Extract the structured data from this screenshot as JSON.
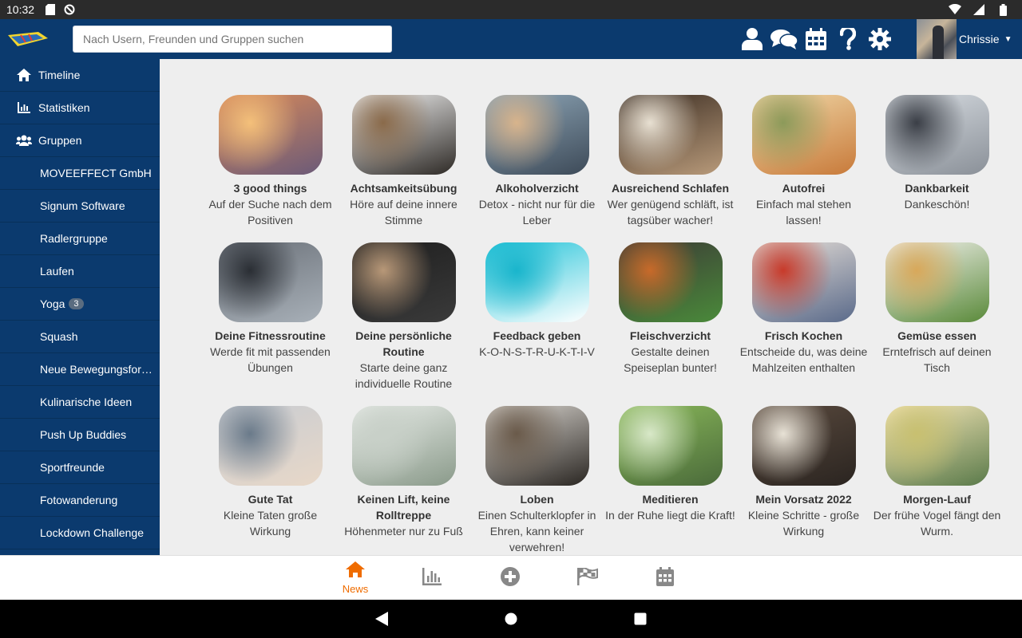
{
  "status_bar": {
    "time": "10:32"
  },
  "header": {
    "search_placeholder": "Nach Usern, Freunden und Gruppen suchen",
    "user_name": "Chrissie"
  },
  "sidebar": {
    "items": [
      {
        "label": "Timeline",
        "icon": "home-icon"
      },
      {
        "label": "Statistiken",
        "icon": "bar-chart-icon"
      },
      {
        "label": "Gruppen",
        "icon": "users-icon"
      }
    ],
    "groups": [
      {
        "label": "MOVEEFFECT GmbH"
      },
      {
        "label": "Signum Software"
      },
      {
        "label": "Radlergruppe"
      },
      {
        "label": "Laufen"
      },
      {
        "label": "Yoga",
        "badge": "3"
      },
      {
        "label": "Squash"
      },
      {
        "label": "Neue Bewegungsform..."
      },
      {
        "label": "Kulinarische Ideen"
      },
      {
        "label": "Push Up Buddies"
      },
      {
        "label": "Sportfreunde"
      },
      {
        "label": "Fotowanderung"
      },
      {
        "label": "Lockdown Challenge"
      }
    ]
  },
  "challenges": [
    {
      "title": "3 good things",
      "desc": "Auf der Suche nach dem Positiven",
      "colors": [
        "#d88a5a",
        "#f4c07a",
        "#6b5a78"
      ]
    },
    {
      "title": "Achtsamkeitsübung",
      "desc": "Höre auf deine innere Stimme",
      "colors": [
        "#f2f2f2",
        "#8a6a4a",
        "#2e2a26"
      ]
    },
    {
      "title": "Alkoholverzicht",
      "desc": "Detox - nicht nur für die Leber",
      "colors": [
        "#8fa7b8",
        "#d8b48c",
        "#3d4a58"
      ]
    },
    {
      "title": "Ausreichend Schlafen",
      "desc": "Wer genügend schläft, ist tagsüber wacher!",
      "colors": [
        "#3a2c22",
        "#e8e0d2",
        "#b89a7a"
      ]
    },
    {
      "title": "Autofrei",
      "desc": "Einfach mal stehen lassen!",
      "colors": [
        "#f0d8a8",
        "#8c9a5a",
        "#c87a3a"
      ]
    },
    {
      "title": "Dankbarkeit",
      "desc": "Dankeschön!",
      "colors": [
        "#d8dde2",
        "#3a3e46",
        "#8a9098"
      ]
    },
    {
      "title": "Deine Fitnessroutine",
      "desc": "Werde fit mit passenden Übungen",
      "colors": [
        "#6a7078",
        "#2a2e34",
        "#a8b0b8"
      ]
    },
    {
      "title": "Deine persönliche Routine",
      "desc": "Starte deine ganz individuelle Routine",
      "colors": [
        "#1e1e1e",
        "#b89878",
        "#3a3a3a"
      ]
    },
    {
      "title": "Feedback geben",
      "desc": "K-O-N-S-T-R-U-K-T-I-V",
      "colors": [
        "#22c3d8",
        "#19b5cc",
        "#ffffff"
      ]
    },
    {
      "title": "Fleischverzicht",
      "desc": "Gestalte deinen Speiseplan bunter!",
      "colors": [
        "#3c3a36",
        "#c86a2a",
        "#4a8a3a"
      ]
    },
    {
      "title": "Frisch Kochen",
      "desc": "Entscheide du, was deine Mahlzeiten enthalten",
      "colors": [
        "#e8e0d8",
        "#c83a2a",
        "#5a6a8a"
      ]
    },
    {
      "title": "Gemüse essen",
      "desc": "Erntefrisch auf deinen Tisch",
      "colors": [
        "#f4f2ee",
        "#d8a85a",
        "#5a8a3a"
      ]
    },
    {
      "title": "Gute Tat",
      "desc": "Kleine Taten große Wirkung",
      "colors": [
        "#c8ccd2",
        "#6a7a8a",
        "#e8d8c8"
      ]
    },
    {
      "title": "Keinen Lift, keine Rolltreppe",
      "desc": "Höhenmeter nur zu Fuß",
      "colors": [
        "#e8ece8",
        "#c8d0c8",
        "#8a9a8a"
      ]
    },
    {
      "title": "Loben",
      "desc": "Einen Schulterklopfer in Ehren, kann keiner verwehren!",
      "colors": [
        "#dad6d0",
        "#6a5a4a",
        "#2a2622"
      ]
    },
    {
      "title": "Meditieren",
      "desc": "In der Ruhe liegt die Kraft!",
      "colors": [
        "#8ab85a",
        "#d8e8c8",
        "#4a6a3a"
      ]
    },
    {
      "title": "Mein Vorsatz 2022",
      "desc": "Kleine Schritte - große Wirkung",
      "colors": [
        "#5a4a3e",
        "#e8e2d6",
        "#2a2420"
      ]
    },
    {
      "title": "Morgen-Lauf",
      "desc": "Der frühe Vogel fängt den Wurm.",
      "colors": [
        "#f8e8b8",
        "#c8c070",
        "#5a7a4a"
      ]
    }
  ],
  "bottom_nav": {
    "active_label": "News",
    "items": [
      "home-icon",
      "stats-icon",
      "plus-circle-icon",
      "flag-icon",
      "calendar-icon"
    ]
  },
  "colors": {
    "primary": "#0b3a6e",
    "accent": "#ef6c00",
    "background": "#eeeeee"
  }
}
